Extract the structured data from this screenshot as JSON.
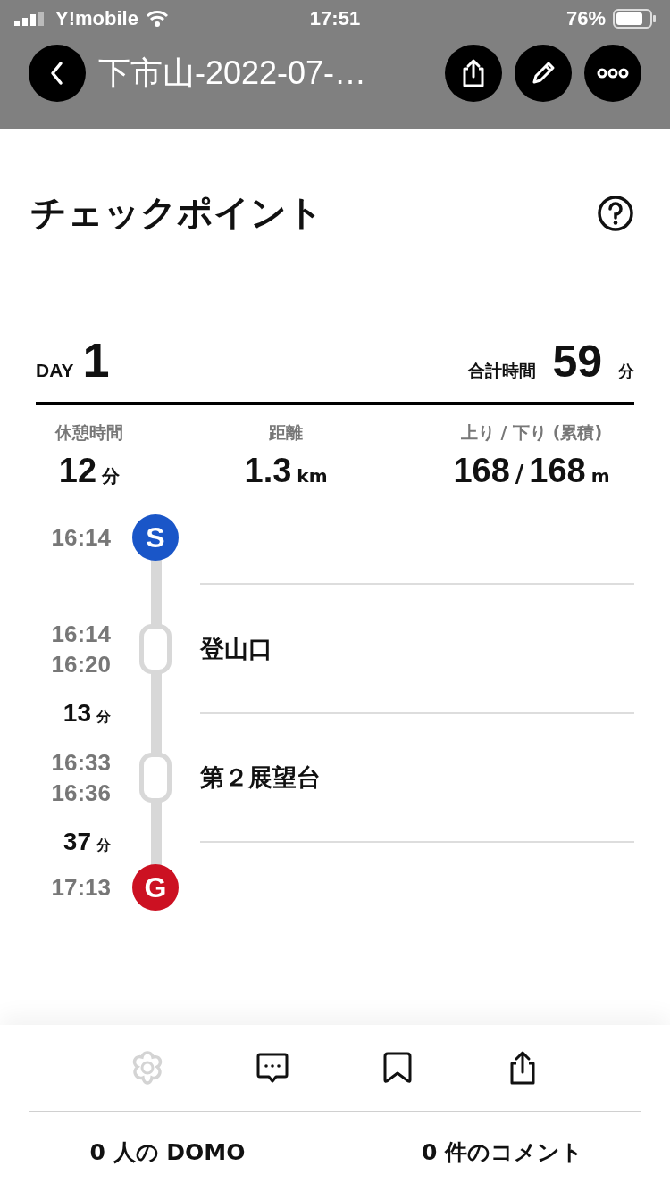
{
  "status_bar": {
    "carrier": "Y!mobile",
    "time": "17:51",
    "battery": "76%"
  },
  "nav": {
    "title": "下市山-2022-07-…"
  },
  "section": {
    "title": "チェックポイント"
  },
  "day": {
    "label": "DAY",
    "number": "1",
    "total_label": "合計時間",
    "total_value": "59",
    "total_unit": "分"
  },
  "stats": [
    {
      "label": "休憩時間",
      "value": "12",
      "unit": "分"
    },
    {
      "label": "距離",
      "value": "1.3",
      "unit": "km"
    },
    {
      "label": "上り / 下り (累積)",
      "value": "168",
      "separator": "/",
      "value2": "168",
      "unit": "m"
    }
  ],
  "timeline": [
    {
      "kind": "start",
      "badge": "S",
      "color": "#1a56c8",
      "times": [
        "16:14"
      ]
    },
    {
      "kind": "checkpoint",
      "times": [
        "16:14",
        "16:20"
      ],
      "name": "登山口"
    },
    {
      "kind": "duration",
      "value": "13",
      "unit": "分"
    },
    {
      "kind": "checkpoint",
      "times": [
        "16:33",
        "16:36"
      ],
      "name": "第２展望台"
    },
    {
      "kind": "duration",
      "value": "37",
      "unit": "分"
    },
    {
      "kind": "goal",
      "badge": "G",
      "color": "#cc1122",
      "times": [
        "17:13"
      ]
    }
  ],
  "actions": {
    "domo_given": false
  },
  "footer": {
    "domo_count": "0 人の DOMO",
    "comment_count": "0 件のコメント"
  }
}
